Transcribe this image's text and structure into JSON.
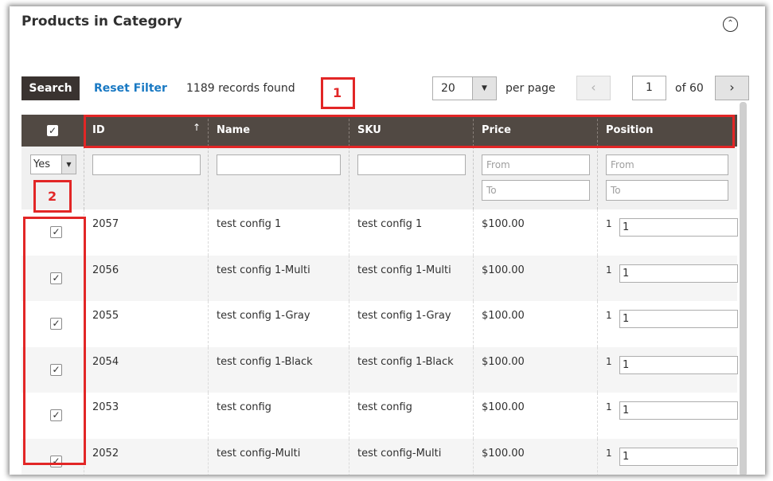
{
  "panel": {
    "title": "Products in Category",
    "collapse_glyph": "⌃"
  },
  "toolbar": {
    "search_label": "Search",
    "reset_label": "Reset Filter",
    "records_text": "1189 records found",
    "per_page_value": "20",
    "per_page_label": "per page",
    "page_value": "1",
    "of_pages": "of 60",
    "prev_glyph": "‹",
    "next_glyph": "›"
  },
  "annotations": [
    "1",
    "2"
  ],
  "grid": {
    "columns": [
      "ID",
      "Name",
      "SKU",
      "Price",
      "Position"
    ],
    "sort_glyph": "↑",
    "header_check_glyph": "✓",
    "filters": {
      "in_category_value": "Yes",
      "price_from_placeholder": "From",
      "price_to_placeholder": "To",
      "position_from_placeholder": "From",
      "position_to_placeholder": "To"
    },
    "rows": [
      {
        "checked": "✓",
        "id": "2057",
        "name": "test config 1",
        "sku": "test config 1",
        "price": "$100.00",
        "position_label": "1",
        "position_value": "1"
      },
      {
        "checked": "✓",
        "id": "2056",
        "name": "test config 1-Multi",
        "sku": "test config 1-Multi",
        "price": "$100.00",
        "position_label": "1",
        "position_value": "1"
      },
      {
        "checked": "✓",
        "id": "2055",
        "name": "test config 1-Gray",
        "sku": "test config 1-Gray",
        "price": "$100.00",
        "position_label": "1",
        "position_value": "1"
      },
      {
        "checked": "✓",
        "id": "2054",
        "name": "test config 1-Black",
        "sku": "test config 1-Black",
        "price": "$100.00",
        "position_label": "1",
        "position_value": "1"
      },
      {
        "checked": "✓",
        "id": "2053",
        "name": "test config",
        "sku": "test config",
        "price": "$100.00",
        "position_label": "1",
        "position_value": "1"
      },
      {
        "checked": "✓",
        "id": "2052",
        "name": "test config-Multi",
        "sku": "test config-Multi",
        "price": "$100.00",
        "position_label": "1",
        "position_value": "1"
      }
    ]
  },
  "colors": {
    "header_bg": "#514943",
    "search_bg": "#3a3330",
    "link": "#1979c3",
    "annotation": "#e22626"
  }
}
